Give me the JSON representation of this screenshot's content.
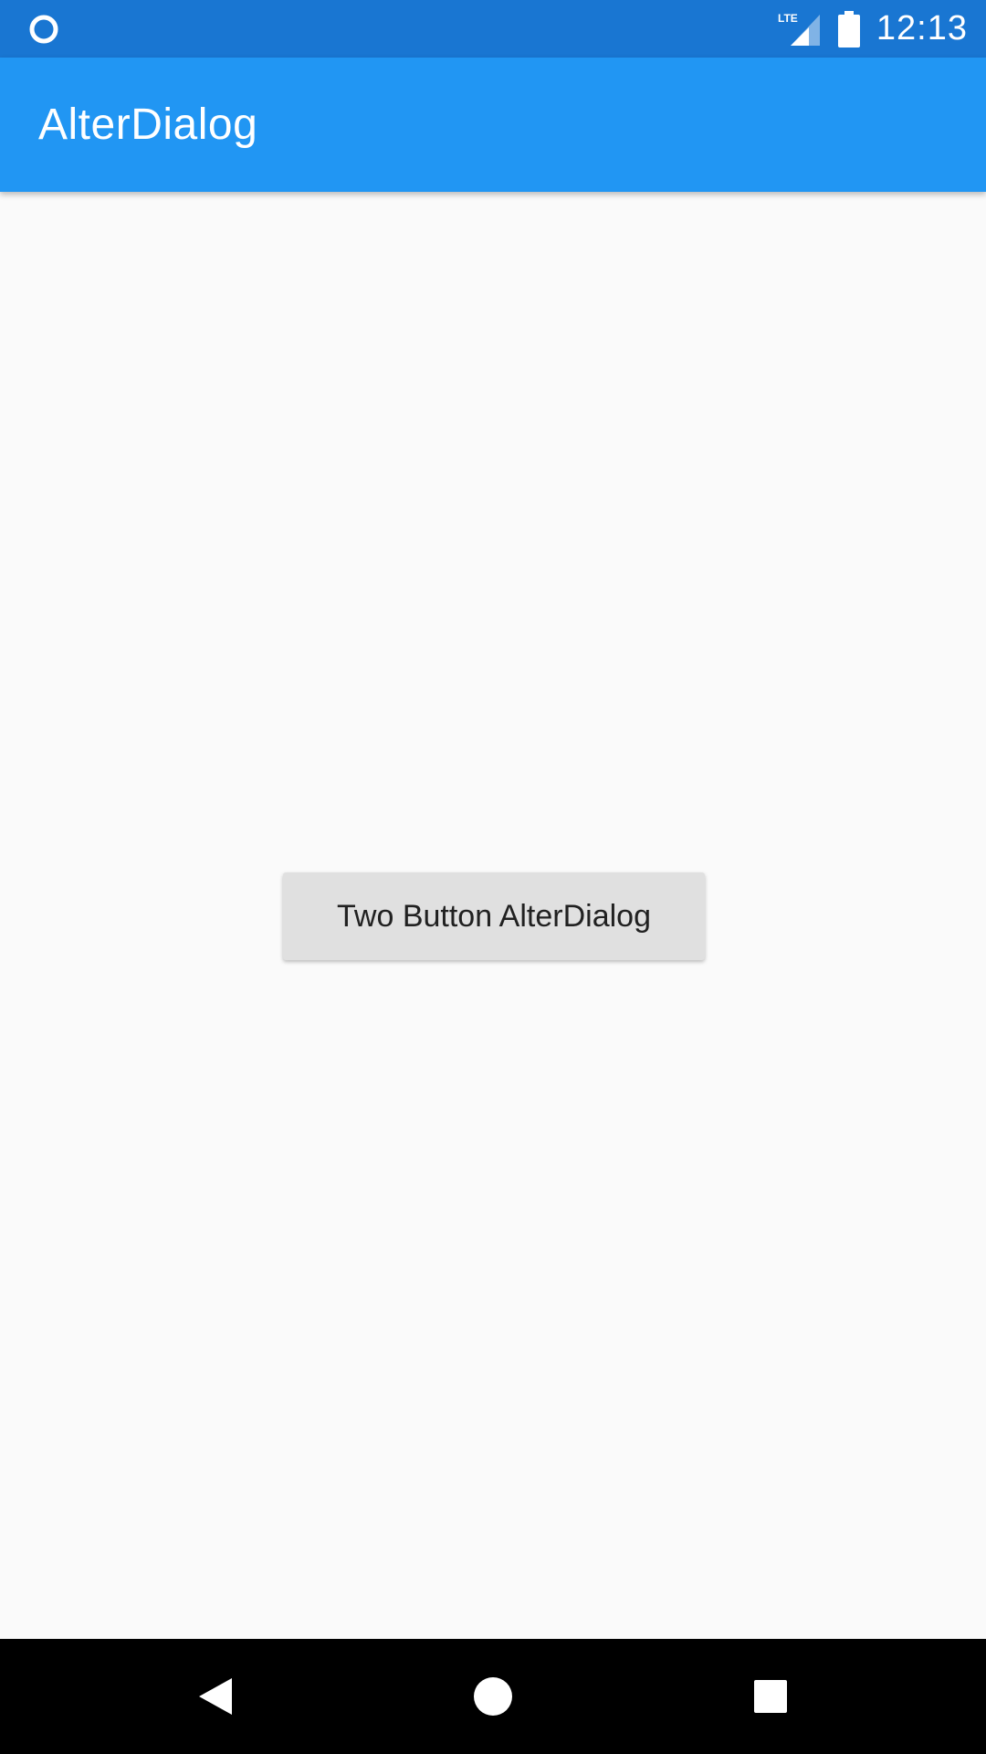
{
  "status_bar": {
    "time": "12:13",
    "network_label": "LTE",
    "icons": [
      "notification-circle-icon",
      "lte-signal-icon",
      "battery-icon"
    ]
  },
  "app_bar": {
    "title": "AlterDialog",
    "color": "#2196f3"
  },
  "main": {
    "button_label": "Two Button AlterDialog"
  },
  "nav_bar": {
    "icons": [
      "back-icon",
      "home-icon",
      "recents-icon"
    ]
  },
  "colors": {
    "status_bar": "#1976d2",
    "app_bar": "#2196f3",
    "background": "#fafafa",
    "button": "#e0e0e0",
    "nav_bar": "#000000"
  }
}
